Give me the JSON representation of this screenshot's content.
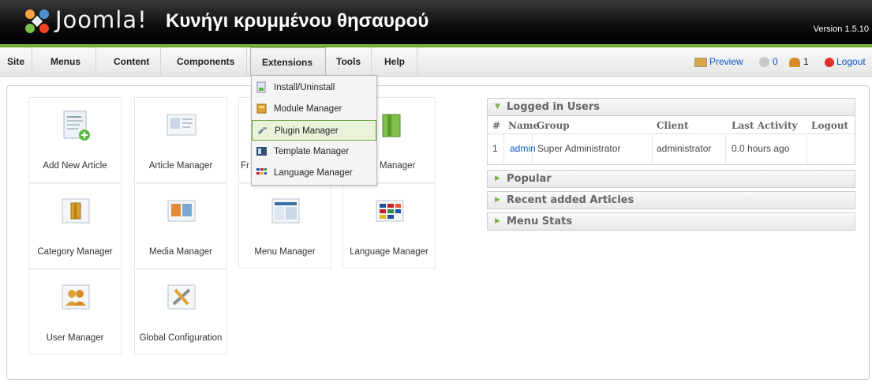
{
  "header": {
    "brand": "Joomla!",
    "site_title": "Κυνήγι κρυμμένου θησαυρού",
    "version": "Version 1.5.10",
    "accent_color": "#6aa842"
  },
  "menu": {
    "items": [
      "Site",
      "Menus",
      "Content",
      "Components",
      "Extensions",
      "Tools",
      "Help"
    ],
    "active": "Extensions"
  },
  "status": {
    "preview": "Preview",
    "messages": "0",
    "users": "1",
    "logout": "Logout"
  },
  "dropdown": {
    "items": [
      {
        "label": "Install/Uninstall",
        "icon": "install-icon"
      },
      {
        "label": "Module Manager",
        "icon": "module-icon"
      },
      {
        "label": "Plugin Manager",
        "icon": "plugin-icon"
      },
      {
        "label": "Template Manager",
        "icon": "template-icon"
      },
      {
        "label": "Language Manager",
        "icon": "language-icon"
      }
    ],
    "hovered": "Plugin Manager"
  },
  "icons": [
    {
      "label": "Add New Article",
      "icon": "add-article-icon"
    },
    {
      "label": "Article Manager",
      "icon": "article-icon"
    },
    {
      "label": "Fr",
      "icon": "frontpage-icon"
    },
    {
      "label": "on Manager",
      "icon": "section-icon"
    },
    {
      "label": "Category Manager",
      "icon": "category-icon"
    },
    {
      "label": "Media Manager",
      "icon": "media-icon"
    },
    {
      "label": "Menu Manager",
      "icon": "menu-icon"
    },
    {
      "label": "Language Manager",
      "icon": "language-icon"
    },
    {
      "label": "User Manager",
      "icon": "user-icon"
    },
    {
      "label": "Global Configuration",
      "icon": "config-icon"
    }
  ],
  "panels": {
    "logged_in": {
      "title": "Logged in Users",
      "columns": [
        "#",
        "Name",
        "Group",
        "Client",
        "Last Activity",
        "Logout"
      ],
      "rows": [
        {
          "num": "1",
          "name": "admin",
          "group": "Super Administrator",
          "client": "administrator",
          "activity": "0.0 hours ago",
          "logout": ""
        }
      ]
    },
    "collapsed": [
      "Popular",
      "Recent added Articles",
      "Menu Stats"
    ]
  }
}
